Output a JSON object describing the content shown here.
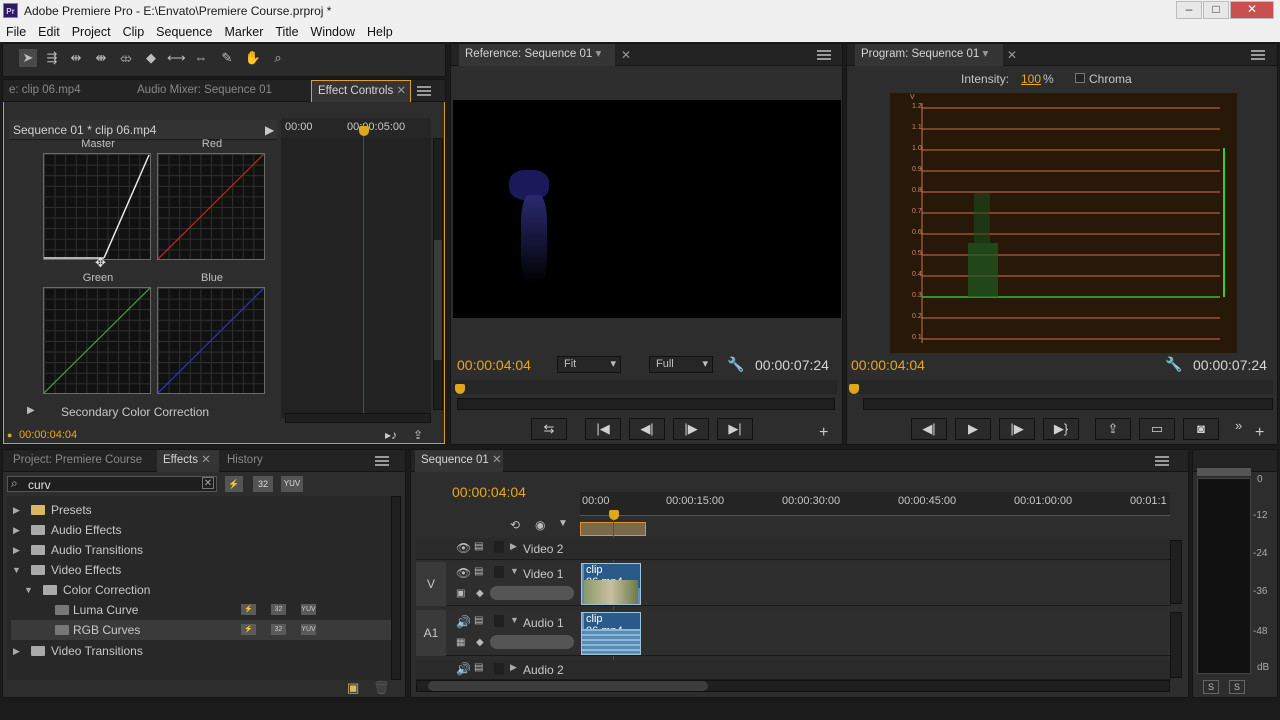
{
  "window": {
    "title": "Adobe Premiere Pro - E:\\Envato\\Premiere Course.prproj *",
    "app_icon": "Pr"
  },
  "menu": [
    "File",
    "Edit",
    "Project",
    "Clip",
    "Sequence",
    "Marker",
    "Title",
    "Window",
    "Help"
  ],
  "effect_panel": {
    "tabs": [
      "e: clip 06.mp4",
      "Audio Mixer: Sequence 01",
      "Effect Controls"
    ],
    "header": "Sequence 01 * clip 06.mp4",
    "time_start": "00:00",
    "time_end": "00:00:05:00",
    "curves": {
      "master": "Master",
      "red": "Red",
      "green": "Green",
      "blue": "Blue"
    },
    "secondary": "Secondary Color Correction",
    "timecode": "00:00:04:04"
  },
  "reference": {
    "tab": "Reference: Sequence 01",
    "timecode": "00:00:04:04",
    "fit": "Fit",
    "quality": "Full",
    "duration": "00:00:07:24"
  },
  "program": {
    "tab": "Program: Sequence 01",
    "intensity_label": "Intensity:",
    "intensity_value": "100",
    "percent": "%",
    "chroma": "Chroma",
    "timecode": "00:00:04:04",
    "duration": "00:00:07:24",
    "scope_labels": [
      "1.2",
      "1.1",
      "1.0",
      "0.9",
      "0.8",
      "0.7",
      "0.6",
      "0.5",
      "0.4",
      "0.3",
      "0.2",
      "0.1"
    ],
    "scope_unit": "V"
  },
  "project": {
    "tabs": [
      "Project: Premiere Course",
      "Effects",
      "History"
    ],
    "search": "curv",
    "icons": [
      "32",
      "YUV"
    ],
    "items": [
      {
        "label": "Presets",
        "level": 0
      },
      {
        "label": "Audio Effects",
        "level": 0
      },
      {
        "label": "Audio Transitions",
        "level": 0
      },
      {
        "label": "Video Effects",
        "level": 0,
        "open": true
      },
      {
        "label": "Color Correction",
        "level": 1,
        "open": true
      },
      {
        "label": "Luma Curve",
        "level": 2,
        "effect": true
      },
      {
        "label": "RGB Curves",
        "level": 2,
        "effect": true,
        "selected": true
      },
      {
        "label": "Video Transitions",
        "level": 0
      }
    ]
  },
  "sequence": {
    "tab": "Sequence 01",
    "timecode": "00:00:04:04",
    "ruler": [
      "00:00",
      "00:00:15:00",
      "00:00:30:00",
      "00:00:45:00",
      "00:01:00:00",
      "00:01:1"
    ],
    "tracks": [
      {
        "name": "Video 2"
      },
      {
        "name": "Video 1",
        "label": "V"
      },
      {
        "name": "Audio 1",
        "label": "A1"
      },
      {
        "name": "Audio 2"
      }
    ],
    "clip": "clip 06.mp4"
  },
  "meter": {
    "labels": [
      "0",
      "-12",
      "-24",
      "-36",
      "-48",
      "dB"
    ],
    "solo": "S"
  }
}
